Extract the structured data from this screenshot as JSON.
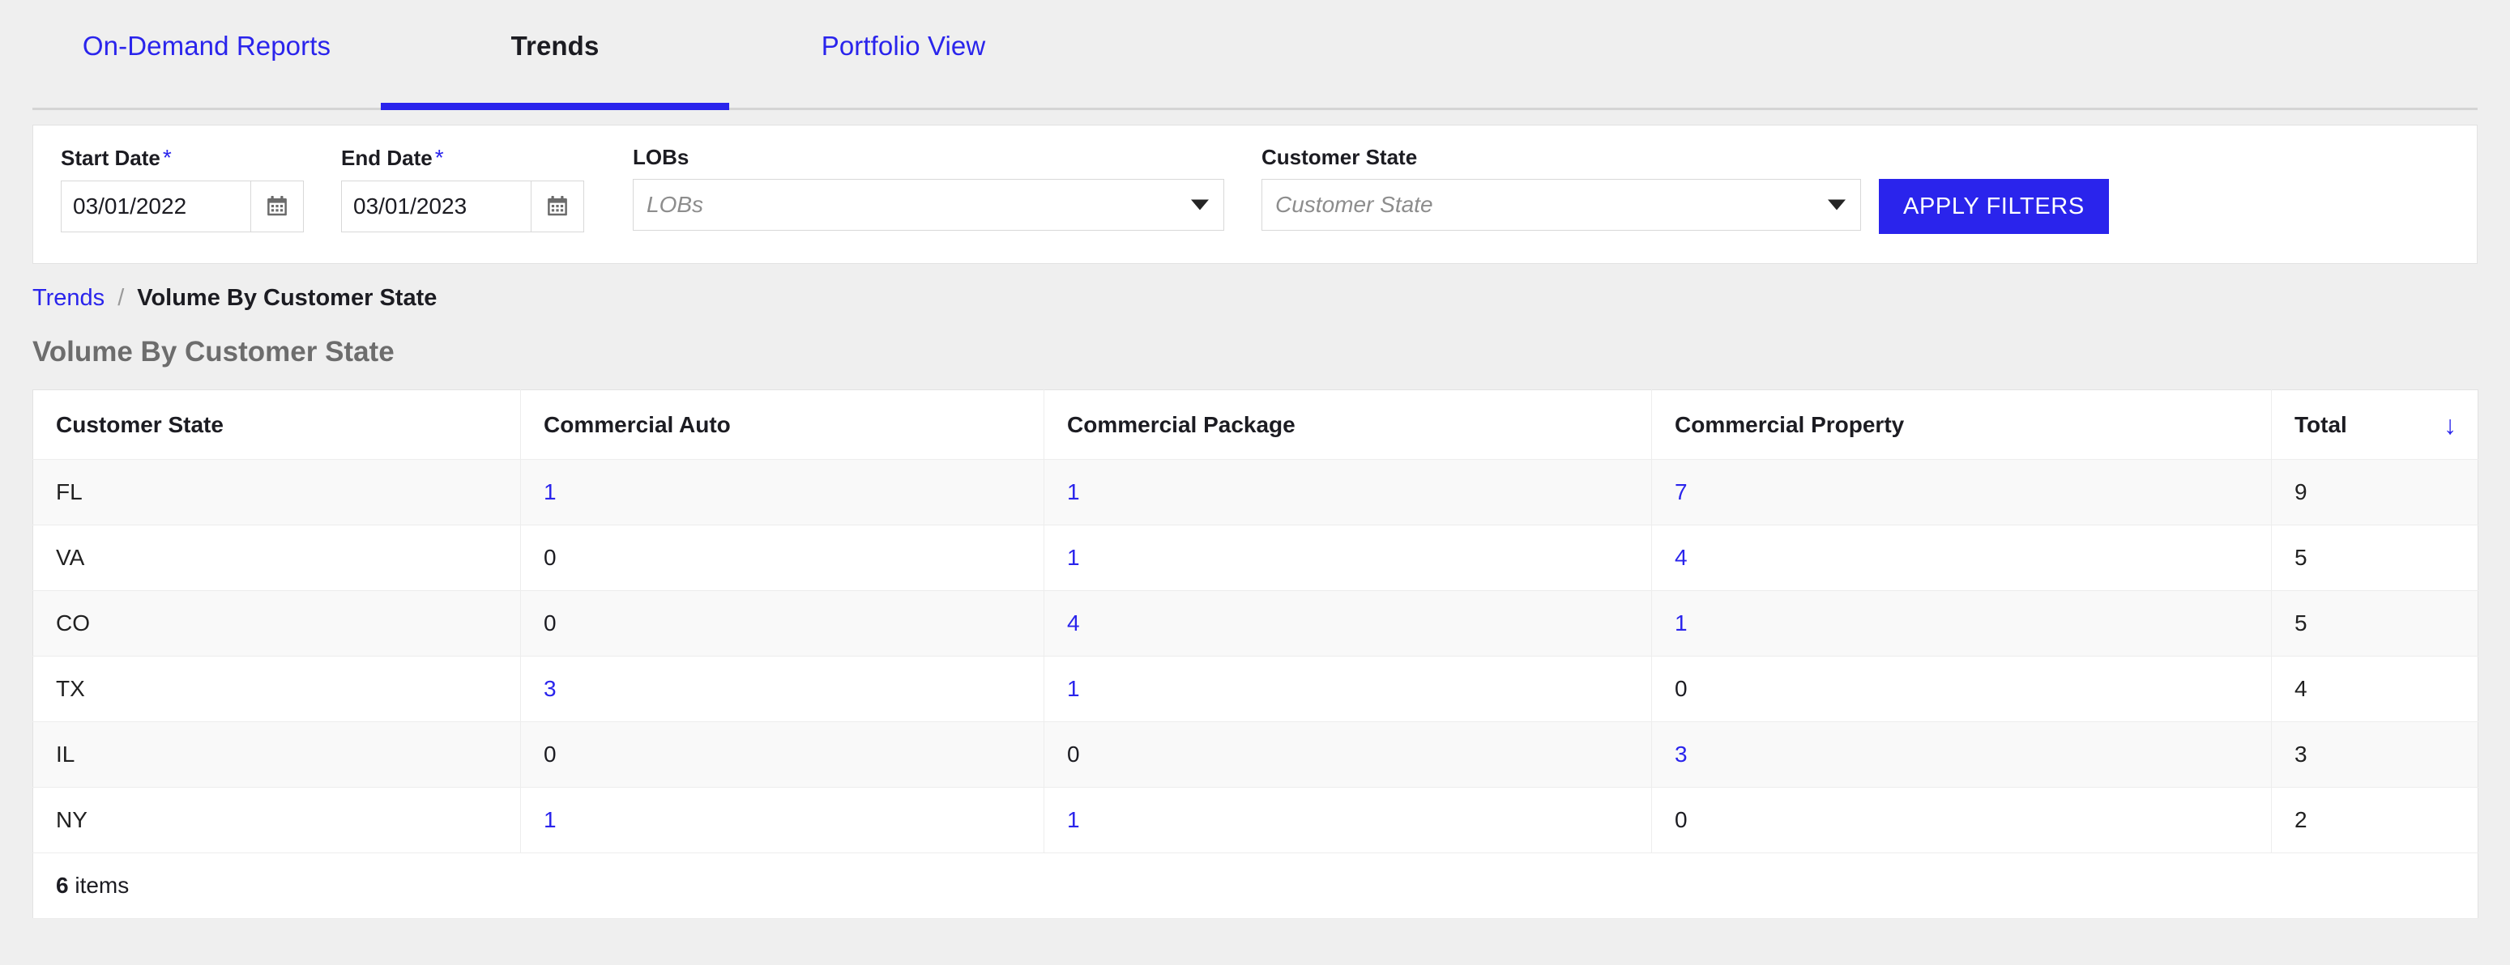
{
  "tabs": [
    {
      "label": "On-Demand Reports",
      "active": false
    },
    {
      "label": "Trends",
      "active": true
    },
    {
      "label": "Portfolio View",
      "active": false
    }
  ],
  "filters": {
    "start_date": {
      "label": "Start Date",
      "required_mark": "*",
      "value": "03/01/2022"
    },
    "end_date": {
      "label": "End Date",
      "required_mark": "*",
      "value": "03/01/2023"
    },
    "lobs": {
      "label": "LOBs",
      "placeholder": "LOBs",
      "value": ""
    },
    "customer_state": {
      "label": "Customer State",
      "placeholder": "Customer State",
      "value": ""
    },
    "apply_label": "APPLY FILTERS"
  },
  "breadcrumb": {
    "parent": "Trends",
    "separator": "/",
    "current": "Volume By Customer State"
  },
  "page": {
    "title": "Volume By Customer State"
  },
  "table": {
    "columns": [
      "Customer State",
      "Commercial Auto",
      "Commercial Package",
      "Commercial Property",
      "Total"
    ],
    "sort_column": "Total",
    "sort_direction": "desc",
    "sort_icon": "arrow-down-icon",
    "rows": [
      {
        "state": "FL",
        "auto": "1",
        "package": "1",
        "property": "7",
        "total": "9"
      },
      {
        "state": "VA",
        "auto": "0",
        "package": "1",
        "property": "4",
        "total": "5"
      },
      {
        "state": "CO",
        "auto": "0",
        "package": "4",
        "property": "1",
        "total": "5"
      },
      {
        "state": "TX",
        "auto": "3",
        "package": "1",
        "property": "0",
        "total": "4"
      },
      {
        "state": "IL",
        "auto": "0",
        "package": "0",
        "property": "3",
        "total": "3"
      },
      {
        "state": "NY",
        "auto": "1",
        "package": "1",
        "property": "0",
        "total": "2"
      }
    ],
    "footer": {
      "count": "6",
      "label": "items"
    }
  },
  "colors": {
    "accent": "#2a24ec",
    "page_background": "#efefef",
    "card_background": "#ffffff",
    "row_alt_background": "#f9f9f9",
    "title_text": "#6d6d6d"
  }
}
